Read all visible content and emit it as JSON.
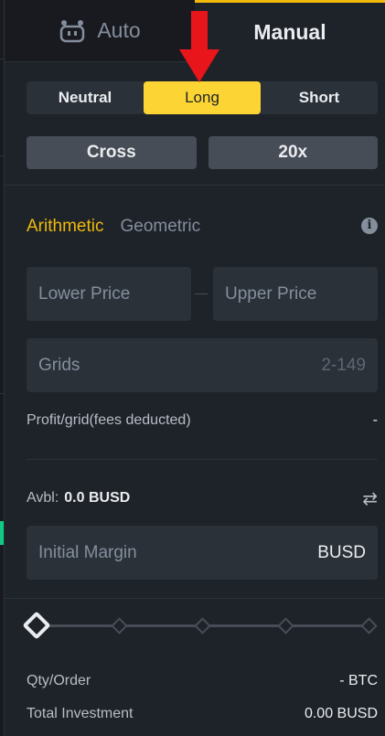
{
  "tabs": {
    "auto_label": "Auto",
    "manual_label": "Manual"
  },
  "position_side": {
    "options": [
      "Neutral",
      "Long",
      "Short"
    ],
    "selected": "Long"
  },
  "margin_mode": "Cross",
  "leverage": "20x",
  "grid_mode": {
    "arithmetic_label": "Arithmetic",
    "geometric_label": "Geometric",
    "selected": "Arithmetic"
  },
  "price_range": {
    "lower_placeholder": "Lower Price",
    "upper_placeholder": "Upper Price"
  },
  "grids": {
    "label": "Grids",
    "range_hint": "2-149"
  },
  "profit_per_grid": {
    "label": "Profit/grid(fees deducted)",
    "value": "-"
  },
  "available": {
    "label": "Avbl:",
    "value": "0.0 BUSD"
  },
  "initial_margin": {
    "placeholder": "Initial Margin",
    "unit": "BUSD"
  },
  "slider": {
    "value_percent": 0
  },
  "qty_order": {
    "label": "Qty/Order",
    "value": "- BTC"
  },
  "total_investment": {
    "label": "Total Investment",
    "value": "0.00 BUSD"
  },
  "colors": {
    "accent": "#f0b90b",
    "active_side": "#fcd535",
    "arrow": "#e8151b",
    "background": "#1e2329"
  }
}
